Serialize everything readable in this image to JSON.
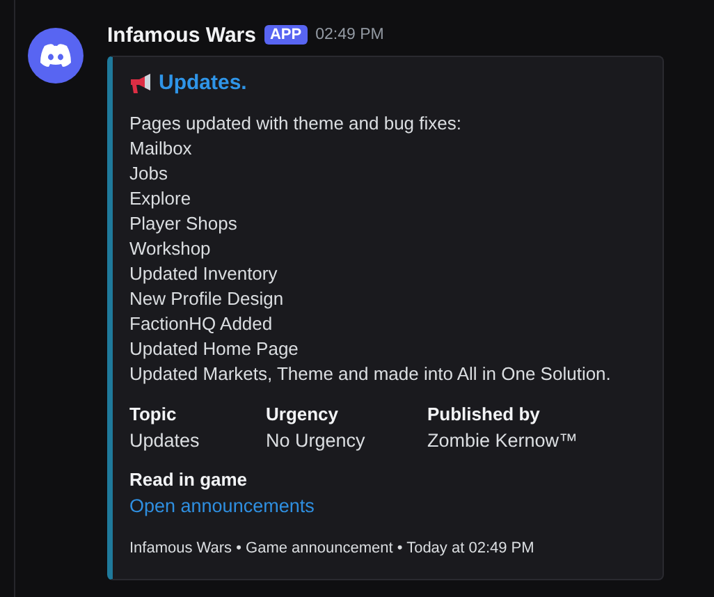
{
  "message": {
    "author": "Infamous Wars",
    "badge": "APP",
    "time": "02:49 PM"
  },
  "embed": {
    "title": "Updates.",
    "description": "Pages updated with theme and bug fixes:\nMailbox\nJobs\nExplore\nPlayer Shops\nWorkshop\nUpdated Inventory\nNew Profile Design\nFactionHQ Added\nUpdated Home Page\nUpdated Markets, Theme and made into All in One Solution.",
    "fields": [
      {
        "name": "Topic",
        "value": "Updates"
      },
      {
        "name": "Urgency",
        "value": "No Urgency"
      },
      {
        "name": "Published by",
        "value": "Zombie Kernow™"
      }
    ],
    "link_field": {
      "name": "Read in game",
      "link": "Open announcements"
    },
    "footer": "Infamous Wars • Game announcement • Today at 02:49 PM"
  }
}
